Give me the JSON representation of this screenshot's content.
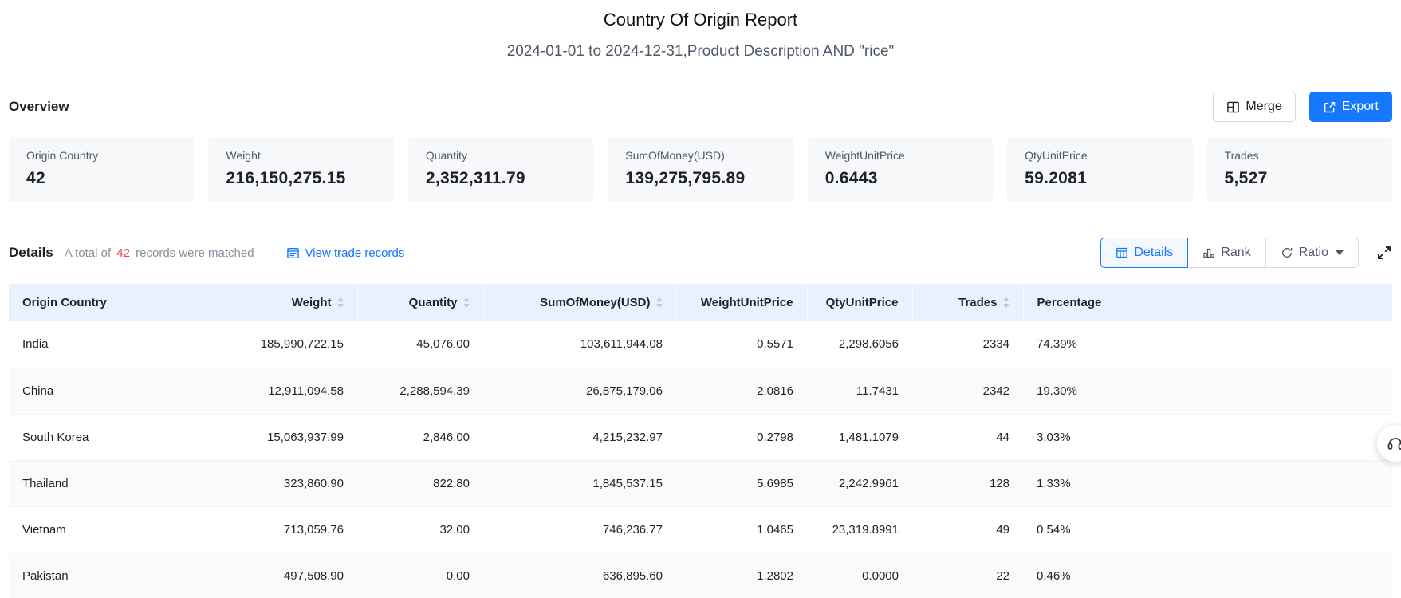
{
  "header": {
    "title": "Country Of Origin Report",
    "subtitle": "2024-01-01 to 2024-12-31,Product Description AND \"rice\""
  },
  "overview": {
    "label": "Overview",
    "merge_label": "Merge",
    "export_label": "Export",
    "cards": [
      {
        "label": "Origin Country",
        "value": "42"
      },
      {
        "label": "Weight",
        "value": "216,150,275.15"
      },
      {
        "label": "Quantity",
        "value": "2,352,311.79"
      },
      {
        "label": "SumOfMoney(USD)",
        "value": "139,275,795.89"
      },
      {
        "label": "WeightUnitPrice",
        "value": "0.6443"
      },
      {
        "label": "QtyUnitPrice",
        "value": "59.2081"
      },
      {
        "label": "Trades",
        "value": "5,527"
      }
    ]
  },
  "details": {
    "label": "Details",
    "matched_prefix": "A total of",
    "matched_count": "42",
    "matched_suffix": "records were matched",
    "view_link": "View trade records",
    "toolbar": {
      "details_label": "Details",
      "rank_label": "Rank",
      "ratio_label": "Ratio"
    }
  },
  "table": {
    "columns": [
      {
        "label": "Origin Country",
        "sortable": false,
        "align": "left"
      },
      {
        "label": "Weight",
        "sortable": true,
        "align": "right"
      },
      {
        "label": "Quantity",
        "sortable": true,
        "align": "right"
      },
      {
        "label": "SumOfMoney(USD)",
        "sortable": true,
        "align": "right"
      },
      {
        "label": "WeightUnitPrice",
        "sortable": false,
        "align": "right"
      },
      {
        "label": "QtyUnitPrice",
        "sortable": false,
        "align": "right"
      },
      {
        "label": "Trades",
        "sortable": true,
        "align": "right"
      },
      {
        "label": "Percentage",
        "sortable": false,
        "align": "left"
      }
    ],
    "rows": [
      [
        "India",
        "185,990,722.15",
        "45,076.00",
        "103,611,944.08",
        "0.5571",
        "2,298.6056",
        "2334",
        "74.39%"
      ],
      [
        "China",
        "12,911,094.58",
        "2,288,594.39",
        "26,875,179.06",
        "2.0816",
        "11.7431",
        "2342",
        "19.30%"
      ],
      [
        "South Korea",
        "15,063,937.99",
        "2,846.00",
        "4,215,232.97",
        "0.2798",
        "1,481.1079",
        "44",
        "3.03%"
      ],
      [
        "Thailand",
        "323,860.90",
        "822.80",
        "1,845,537.15",
        "5.6985",
        "2,242.9961",
        "128",
        "1.33%"
      ],
      [
        "Vietnam",
        "713,059.76",
        "32.00",
        "746,236.77",
        "1.0465",
        "23,319.8991",
        "49",
        "0.54%"
      ],
      [
        "Pakistan",
        "497,508.90",
        "0.00",
        "636,895.60",
        "1.2802",
        "0.0000",
        "22",
        "0.46%"
      ]
    ]
  },
  "colors": {
    "accent": "#1677ff",
    "table_header_bg": "#e8f1fc",
    "matched_count_color": "#f53f3f"
  }
}
